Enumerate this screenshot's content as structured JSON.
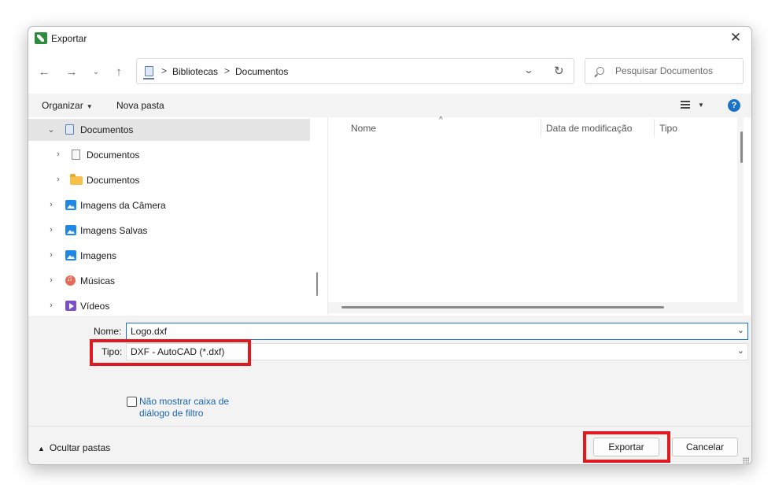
{
  "window": {
    "title": "Exportar",
    "close_icon": "close-icon"
  },
  "address": {
    "crumbs": [
      "Bibliotecas",
      "Documentos"
    ],
    "separator": ">"
  },
  "search": {
    "placeholder": "Pesquisar Documentos"
  },
  "toolbar": {
    "organize_label": "Organizar",
    "new_folder_label": "Nova pasta",
    "help_label": "?"
  },
  "nav_tree": {
    "items": [
      {
        "label": "Documentos",
        "icon": "library-documents-icon",
        "expanded": true,
        "selected": true
      },
      {
        "label": "Documentos",
        "icon": "document-icon"
      },
      {
        "label": "Documentos",
        "icon": "folder-icon"
      },
      {
        "label": "Imagens da Câmera",
        "icon": "image-icon"
      },
      {
        "label": "Imagens Salvas",
        "icon": "image-icon"
      },
      {
        "label": "Imagens",
        "icon": "image-icon"
      },
      {
        "label": "Músicas",
        "icon": "music-icon"
      },
      {
        "label": "Vídeos",
        "icon": "video-icon"
      }
    ]
  },
  "file_list": {
    "columns": [
      "Nome",
      "Data de modificação",
      "Tipo"
    ]
  },
  "form": {
    "name_label": "Nome:",
    "name_value": "Logo.dxf",
    "type_label": "Tipo:",
    "type_value": "DXF - AutoCAD (*.dxf)",
    "checkbox_label_line1": "Não mostrar caixa de",
    "checkbox_label_line2": "diálogo de filtro",
    "checkbox_checked": false
  },
  "footer": {
    "toggle_folders_label": "Ocultar pastas",
    "export_label": "Exportar",
    "cancel_label": "Cancelar"
  },
  "colors": {
    "accent": "#1a73c9",
    "highlight": "#e0191f",
    "link": "#1a66b0"
  }
}
